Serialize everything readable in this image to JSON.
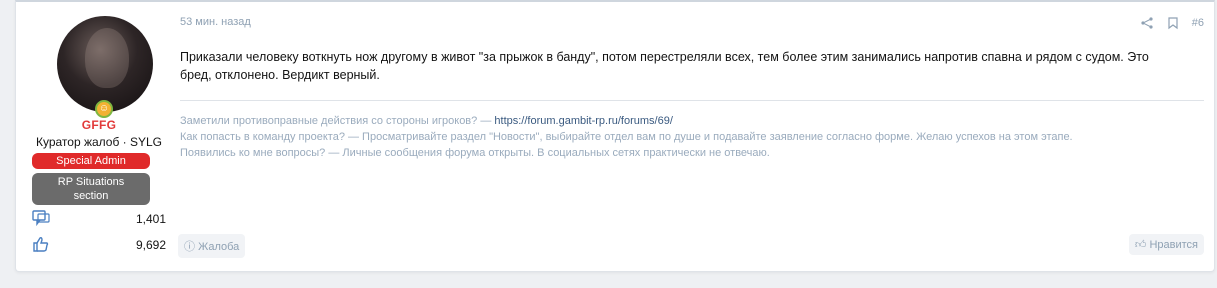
{
  "user": {
    "tag": "GFFG",
    "title": "Куратор жалоб · SYLG",
    "banner_special": "Special Admin",
    "banner_rp_line1": "RP Situations",
    "banner_rp_line2": "section",
    "messages_count": "1,401",
    "reactions_count": "9,692",
    "icons": [
      "avatar",
      "badge-icon",
      "messages-icon",
      "likes-icon"
    ]
  },
  "post": {
    "time": "53 мин. назад",
    "number": "#6",
    "text_line1": "Приказали человеку воткнуть нож другому в живот \"за прыжок в банду\", потом перестреляли всех, тем более этим занимались напротив спавна и рядом с судом. Это",
    "text_line2": "бред, отклонено. Вердикт верный.",
    "signature": {
      "line1_prefix": "Заметили противоправные действия со стороны игроков? — ",
      "line1_link": "https://forum.gambit-rp.ru/forums/69/",
      "line2": "Как попасть в команду проекта? — Просматривайте раздел \"Новости\", выбирайте отдел вам по душе и подавайте заявление согласно форме. Желаю успехов на этом этапе.",
      "line3": "Появились ко мне вопросы? — Личные сообщения форума открыты. В социальных сетях практически не отвечаю."
    },
    "report_label": "Жалоба",
    "like_label": "Нравится",
    "icons": [
      "share-icon",
      "bookmark-icon",
      "report-icon",
      "like-icon"
    ]
  },
  "colors": {
    "tag": "#e23a3a",
    "banner_red": "#e02a2a",
    "banner_grey": "#6b6b6b",
    "muted": "#8fa1b3",
    "link": "#3a5a80"
  }
}
